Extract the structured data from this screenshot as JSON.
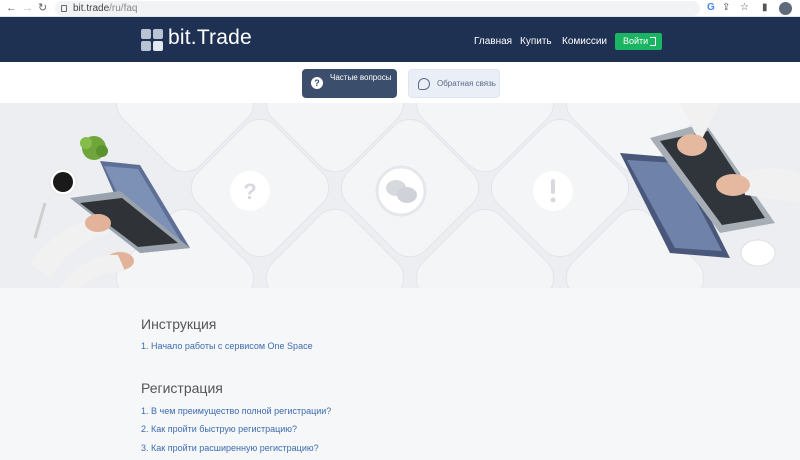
{
  "browser": {
    "url_host": "bit.trade",
    "url_path": "/ru/faq"
  },
  "header": {
    "brand": "bit.Trade",
    "nav": [
      "Главная",
      "Купить",
      "Комиссии"
    ],
    "login_label": "Войти"
  },
  "tabs": [
    {
      "label": "Частые вопросы",
      "icon": "question-icon",
      "active": true
    },
    {
      "label": "Обратная связь",
      "icon": "chat-icon",
      "active": false
    }
  ],
  "hero": {
    "icons": [
      "question-icon",
      "chat-icon",
      "exclamation-icon"
    ]
  },
  "faq": {
    "sections": [
      {
        "title": "Инструкция",
        "items": [
          "1. Начало работы с сервисом One Space"
        ]
      },
      {
        "title": "Регистрация",
        "items": [
          "1. В чем преимущество полной регистрации?",
          "2. Как пройти быструю регистрацию?",
          "3. Как пройти расширенную регистрацию?"
        ]
      }
    ]
  },
  "colors": {
    "header_bg": "#1f3152",
    "login_bg": "#1bb462",
    "tab_active_bg": "#3b4f6c",
    "link": "#3c6bb0"
  }
}
